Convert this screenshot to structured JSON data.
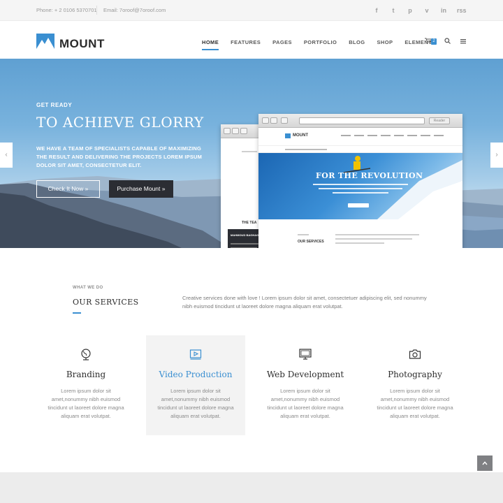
{
  "topbar": {
    "phone": "Phone: + 2 0106 5370701",
    "email": "Email: 7oroof@7oroof.com",
    "socials": [
      {
        "icon": "facebook-icon",
        "glyph": "f"
      },
      {
        "icon": "twitter-icon",
        "glyph": "t"
      },
      {
        "icon": "pinterest-icon",
        "glyph": "p"
      },
      {
        "icon": "vimeo-icon",
        "glyph": "v"
      },
      {
        "icon": "linkedin-icon",
        "glyph": "in"
      },
      {
        "icon": "rss-icon",
        "glyph": "rss"
      }
    ]
  },
  "header": {
    "logo_text": "MOUNT",
    "nav": [
      "HOME",
      "FEATURES",
      "PAGES",
      "PORTFOLIO",
      "BLOG",
      "SHOP",
      "ELEMENTS"
    ],
    "cart_count": "2",
    "search_glyph": "⚲",
    "menu_glyph": "≡",
    "cart_glyph": "🛒"
  },
  "hero": {
    "kicker": "GET READY",
    "title": "TO ACHIEVE GLORRY",
    "desc": "WE HAVE A TEAM OF SPECIALISTS CAPABLE OF MAXIMIZING THE RESULT AND DELIVERING THE PROJECTS LOREM IPSUM DOLOR SIT AMET, CONSECTETUR ELIT.",
    "btn_primary": "Check It Now  »",
    "btn_secondary": "Purchase Mount  »",
    "prev_glyph": "‹",
    "next_glyph": "›",
    "mock": {
      "logo": "MOUNT",
      "reader": "Reader",
      "slide_title": "FOR THE REVOLUTION",
      "services": "OUR SERVICES",
      "back_title": "THE TEA",
      "back_dark_title": "MAHMOUD BAGHAG"
    }
  },
  "services": {
    "kicker": "WHAT WE DO",
    "heading": "OUR SERVICES",
    "intro": "Creative services done with love ! Lorem ipsum dolor sit amet, consectetuer adipiscing elit, sed nonummy nibh euismod tincidunt ut laoreet dolore magna aliquam erat volutpat.",
    "items": [
      {
        "icon": "globe-icon",
        "name": "Branding",
        "text": "Lorem ipsum dolor sit amet,nonummy nibh euismod tincidunt ut laoreet dolore magna aliquam erat volutpat."
      },
      {
        "icon": "video-play-icon",
        "name": "Video Production",
        "text": "Lorem ipsum dolor sit amet,nonummy nibh euismod tincidunt ut laoreet dolore magna aliquam erat volutpat."
      },
      {
        "icon": "monitor-icon",
        "name": "Web Development",
        "text": "Lorem ipsum dolor sit amet,nonummy nibh euismod tincidunt ut laoreet dolore magna aliquam erat volutpat."
      },
      {
        "icon": "camera-icon",
        "name": "Photography",
        "text": "Lorem ipsum dolor sit amet,nonummy nibh euismod tincidunt ut laoreet dolore magna aliquam erat volutpat."
      }
    ]
  },
  "back_to_top_glyph": "^",
  "colors": {
    "accent": "#3a8fd1",
    "dark_button": "#2b2d33",
    "highlight_bg": "#f3f3f3"
  }
}
